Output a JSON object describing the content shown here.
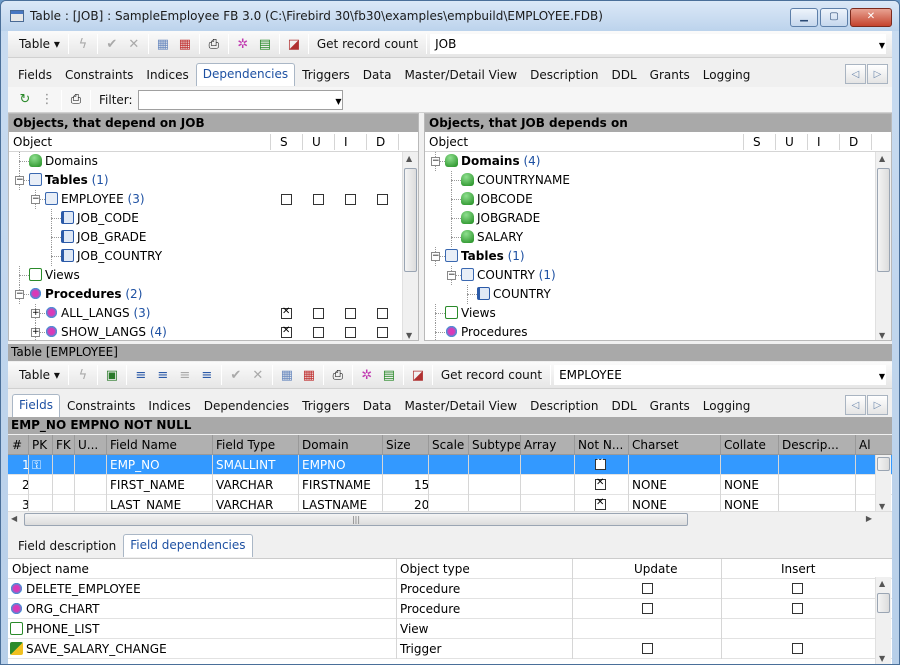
{
  "window": {
    "title": "Table : [JOB] : SampleEmployee FB 3.0 (C:\\Firebird 30\\fb30\\examples\\empbuild\\EMPLOYEE.FDB)"
  },
  "toolbar1": {
    "table_label": "Table",
    "get_record_count": "Get record count",
    "object_name": "JOB"
  },
  "tabs1": [
    "Fields",
    "Constraints",
    "Indices",
    "Dependencies",
    "Triggers",
    "Data",
    "Master/Detail View",
    "Description",
    "DDL",
    "Grants",
    "Logging"
  ],
  "tabs1_active": 3,
  "depbar": {
    "filter_label": "Filter:",
    "filter_value": ""
  },
  "left_panel": {
    "title": "Objects, that depend on JOB",
    "columns": [
      "Object",
      "S",
      "U",
      "I",
      "D"
    ],
    "rows": [
      {
        "level": 0,
        "icon": "domain-icon",
        "text": "Domains",
        "count": "",
        "bold": false,
        "expander": "",
        "checks": []
      },
      {
        "level": 0,
        "icon": "table-icon",
        "text": "Tables",
        "count": "(1)",
        "bold": true,
        "expander": "−",
        "checks": []
      },
      {
        "level": 1,
        "icon": "table-icon",
        "text": "EMPLOYEE",
        "count": "(3)",
        "bold": false,
        "expander": "−",
        "checks": [
          false,
          false,
          false,
          false
        ]
      },
      {
        "level": 2,
        "icon": "field-icon",
        "text": "JOB_CODE",
        "count": "",
        "bold": false,
        "expander": "",
        "checks": []
      },
      {
        "level": 2,
        "icon": "field-icon",
        "text": "JOB_GRADE",
        "count": "",
        "bold": false,
        "expander": "",
        "checks": []
      },
      {
        "level": 2,
        "icon": "field-icon",
        "text": "JOB_COUNTRY",
        "count": "",
        "bold": false,
        "expander": "",
        "checks": []
      },
      {
        "level": 0,
        "icon": "view-icon",
        "text": "Views",
        "count": "",
        "bold": false,
        "expander": "",
        "checks": []
      },
      {
        "level": 0,
        "icon": "procedure-icon",
        "text": "Procedures",
        "count": "(2)",
        "bold": true,
        "expander": "−",
        "checks": []
      },
      {
        "level": 1,
        "icon": "procedure-icon",
        "text": "ALL_LANGS",
        "count": "(3)",
        "bold": false,
        "expander": "+",
        "checks": [
          true,
          false,
          false,
          false
        ]
      },
      {
        "level": 1,
        "icon": "procedure-icon",
        "text": "SHOW_LANGS",
        "count": "(4)",
        "bold": false,
        "expander": "+",
        "checks": [
          true,
          false,
          false,
          false
        ]
      }
    ]
  },
  "right_panel": {
    "title": "Objects, that JOB depends on",
    "columns": [
      "Object",
      "S",
      "U",
      "I",
      "D"
    ],
    "rows": [
      {
        "level": 0,
        "icon": "domain-icon",
        "text": "Domains",
        "count": "(4)",
        "bold": true,
        "expander": "−"
      },
      {
        "level": 1,
        "icon": "domain-icon",
        "text": "COUNTRYNAME",
        "count": "",
        "bold": false,
        "expander": ""
      },
      {
        "level": 1,
        "icon": "domain-icon",
        "text": "JOBCODE",
        "count": "",
        "bold": false,
        "expander": ""
      },
      {
        "level": 1,
        "icon": "domain-icon",
        "text": "JOBGRADE",
        "count": "",
        "bold": false,
        "expander": ""
      },
      {
        "level": 1,
        "icon": "domain-icon",
        "text": "SALARY",
        "count": "",
        "bold": false,
        "expander": ""
      },
      {
        "level": 0,
        "icon": "table-icon",
        "text": "Tables",
        "count": "(1)",
        "bold": true,
        "expander": "−"
      },
      {
        "level": 1,
        "icon": "table-icon",
        "text": "COUNTRY",
        "count": "(1)",
        "bold": false,
        "expander": "−"
      },
      {
        "level": 2,
        "icon": "field-icon",
        "text": "COUNTRY",
        "count": "",
        "bold": false,
        "expander": ""
      },
      {
        "level": 0,
        "icon": "view-icon",
        "text": "Views",
        "count": "",
        "bold": false,
        "expander": ""
      },
      {
        "level": 0,
        "icon": "procedure-icon",
        "text": "Procedures",
        "count": "",
        "bold": false,
        "expander": ""
      }
    ]
  },
  "lower": {
    "section_title": "Table [EMPLOYEE]",
    "table_label": "Table",
    "get_record_count": "Get record count",
    "object_name": "EMPLOYEE"
  },
  "tabs2": [
    "Fields",
    "Constraints",
    "Indices",
    "Dependencies",
    "Triggers",
    "Data",
    "Master/Detail View",
    "Description",
    "DDL",
    "Grants",
    "Logging"
  ],
  "tabs2_active": 0,
  "field_header": "EMP_NO EMPNO NOT NULL",
  "fields_grid": {
    "columns": [
      "#",
      "PK",
      "FK",
      "U...",
      "Field Name",
      "Field Type",
      "Domain",
      "Size",
      "Scale",
      "Subtype",
      "Array",
      "Not N...",
      "Charset",
      "Collate",
      "Descrip...",
      "Al"
    ],
    "rows": [
      {
        "n": "1",
        "pk": "key",
        "name": "EMP_NO",
        "type": "SMALLINT",
        "domain": "EMPNO",
        "size": "",
        "notnull": true,
        "charset": "",
        "collate": ""
      },
      {
        "n": "2",
        "pk": "",
        "name": "FIRST_NAME",
        "type": "VARCHAR",
        "domain": "FIRSTNAME",
        "size": "15",
        "notnull": true,
        "charset": "NONE",
        "collate": "NONE"
      },
      {
        "n": "3",
        "pk": "",
        "name": "LAST_NAME",
        "type": "VARCHAR",
        "domain": "LASTNAME",
        "size": "20",
        "notnull": true,
        "charset": "NONE",
        "collate": "NONE"
      }
    ]
  },
  "bottom_tabs": [
    "Field description",
    "Field dependencies"
  ],
  "bottom_tabs_active": 1,
  "dep_grid": {
    "columns": [
      "Object name",
      "Object type",
      "Update",
      "Insert"
    ],
    "rows": [
      {
        "icon": "procedure-icon",
        "name": "DELETE_EMPLOYEE",
        "type": "Procedure",
        "update": true,
        "insert": true
      },
      {
        "icon": "procedure-icon",
        "name": "ORG_CHART",
        "type": "Procedure",
        "update": true,
        "insert": true
      },
      {
        "icon": "view-icon",
        "name": "PHONE_LIST",
        "type": "View",
        "update": false,
        "insert": false
      },
      {
        "icon": "trigger-icon",
        "name": "SAVE_SALARY_CHANGE",
        "type": "Trigger",
        "update": true,
        "insert": true
      }
    ]
  }
}
